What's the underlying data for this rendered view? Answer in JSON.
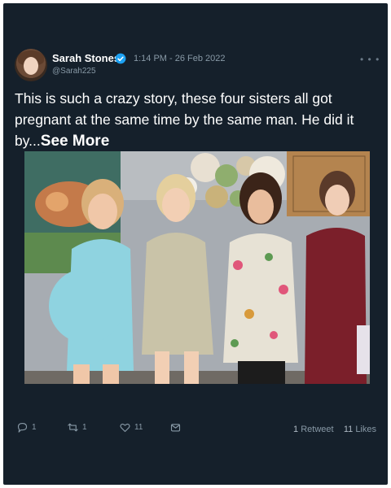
{
  "tweet": {
    "author_name": "Sarah Stones",
    "author_handle": "@Sarah225",
    "timestamp": "1:14 PM - 26 Feb 2022",
    "more_label": "• • •",
    "text": "This is such a crazy story, these four sisters all got pregnant at the same time by the same man. He did it by...",
    "see_more": "See More"
  },
  "actions": {
    "reply_count": "1",
    "retweet_count": "1",
    "like_count": "11"
  },
  "stats": {
    "retweets_number": "1",
    "retweets_label": "Retweet",
    "likes_number": "11",
    "likes_label": "Likes"
  },
  "colors": {
    "background": "#15202b",
    "text": "#ffffff",
    "muted": "#8899a6",
    "verified": "#1da1f2"
  },
  "icons": [
    "verified-badge-icon",
    "more-icon",
    "reply-icon",
    "retweet-icon",
    "like-icon",
    "share-icon"
  ]
}
